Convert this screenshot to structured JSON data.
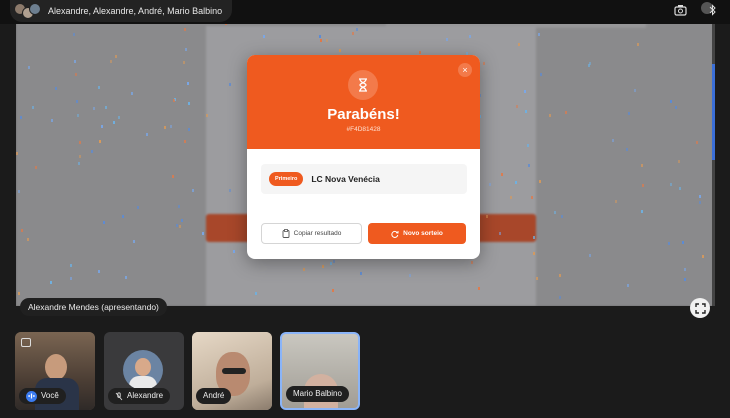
{
  "meeting": {
    "participants_title": "Alexandre, Alexandre, André, Mario Balbino",
    "presenter_label": "Alexandre Mendes (apresentando)"
  },
  "modal": {
    "title": "Parabéns!",
    "code": "#F4D81428",
    "close_glyph": "×",
    "result": {
      "badge": "Primeiro",
      "name": "LC Nova Venécia"
    },
    "copy_label": "Copiar resultado",
    "new_draw_label": "Novo sorteio"
  },
  "tiles": [
    {
      "label": "Você",
      "icon": "speaking-icon"
    },
    {
      "label": "Alexandre",
      "icon": "mic-off-icon"
    },
    {
      "label": "André"
    },
    {
      "label": "Mario Balbino"
    }
  ],
  "colors": {
    "accent": "#ef5a1f",
    "active_tile_border": "#8ab4f8",
    "speaking": "#3a7bf0"
  }
}
